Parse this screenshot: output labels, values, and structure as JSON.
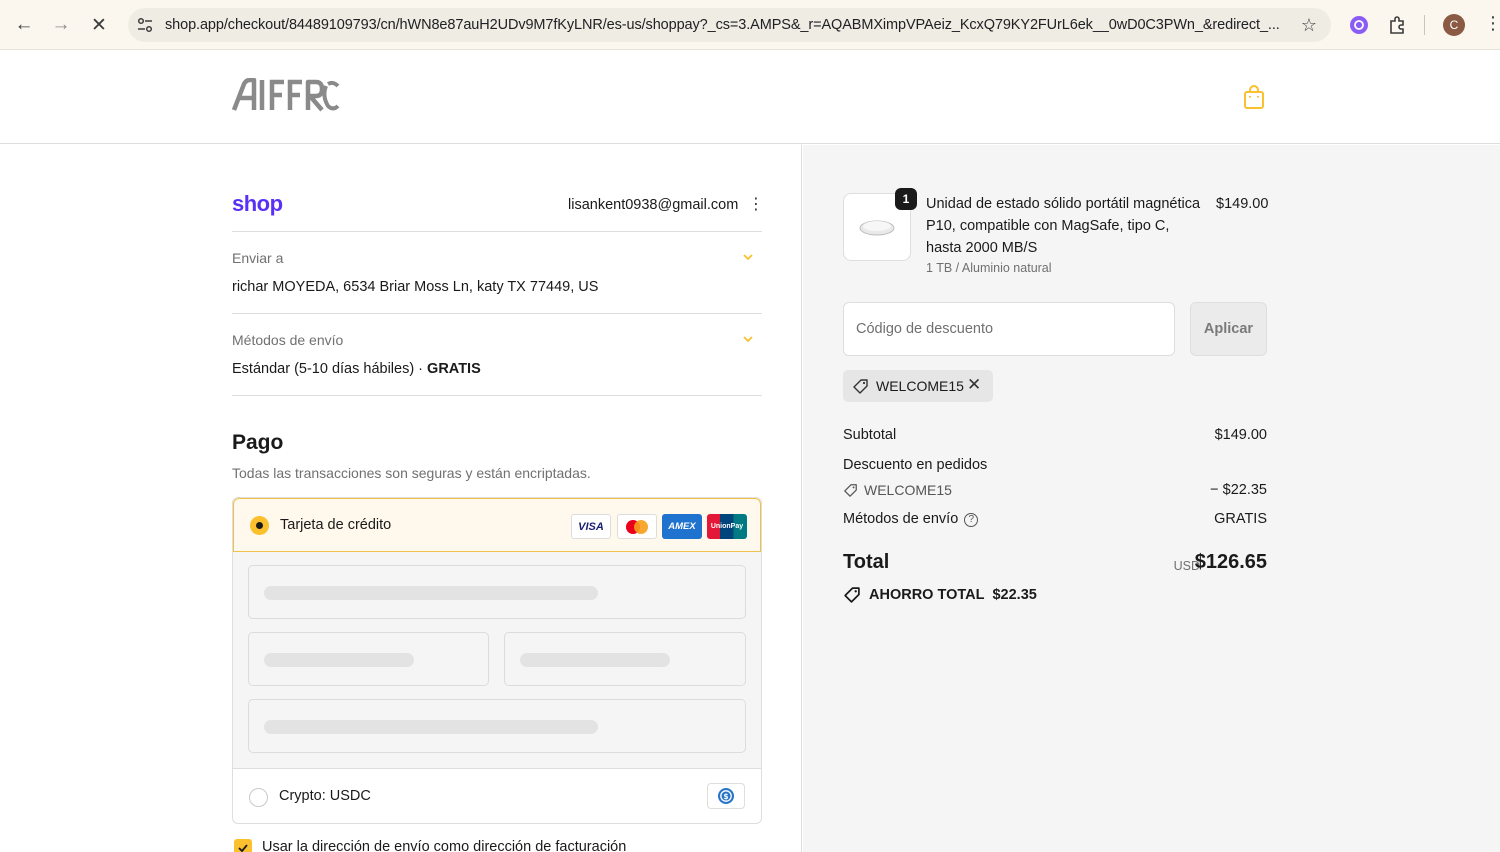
{
  "browser": {
    "url": "shop.app/checkout/84489109793/cn/hWN8e87auH2UDv9M7fKyLNR/es-us/shoppay?_cs=3.AMPS&_r=AQABMXimpVPAeiz_KcxQ79KY2FUrL6ek__0wD0C3PWn_&redirect_...",
    "avatar_letter": "C"
  },
  "header": {
    "logo_text": "AIFFRO"
  },
  "account": {
    "shop_logo": "shop",
    "email": "lisankent0938@gmail.com"
  },
  "shipping": {
    "label": "Enviar a",
    "address": "richar MOYEDA, 6534 Briar Moss Ln, katy TX 77449, US"
  },
  "shipping_method": {
    "label": "Métodos de envío",
    "value": "Estándar (5-10 días hábiles) · ",
    "price": "GRATIS"
  },
  "payment": {
    "title": "Pago",
    "subtitle": "Todas las transacciones son seguras y están encriptadas.",
    "options": [
      {
        "label": "Tarjeta de crédito",
        "selected": true
      },
      {
        "label": "Crypto: USDC",
        "selected": false
      }
    ],
    "card_brands": [
      "VISA",
      "Mastercard",
      "AMEX",
      "UnionPay"
    ],
    "billing_checkbox_label": "Usar la dirección de envío como dirección de facturación",
    "billing_checked": true
  },
  "summary": {
    "item": {
      "quantity": "1",
      "title": "Unidad de estado sólido portátil magnética P10, compatible con MagSafe, tipo C, hasta 2000 MB/S",
      "variant": "1 TB / Aluminio natural",
      "price": "$149.00"
    },
    "discount_placeholder": "Código de descuento",
    "apply_label": "Aplicar",
    "applied_code": "WELCOME15",
    "subtotal_label": "Subtotal",
    "subtotal_value": "$149.00",
    "order_discount_label": "Descuento en pedidos",
    "order_discount_code": "WELCOME15",
    "order_discount_value": "− $22.35",
    "shipping_label": "Métodos de envío",
    "shipping_value": "GRATIS",
    "total_label": "Total",
    "currency": "USD",
    "total_value": "$126.65",
    "savings_label": "AHORRO TOTAL",
    "savings_value": "$22.35"
  },
  "colors": {
    "shop_purple": "#5a31f4",
    "accent_yellow": "#fbc02d"
  }
}
